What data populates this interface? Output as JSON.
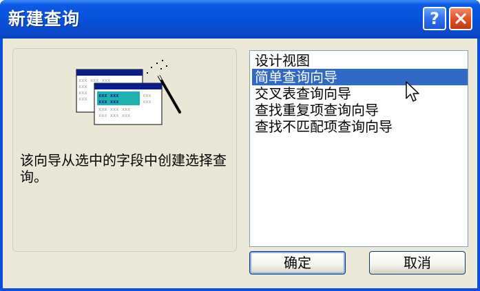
{
  "window": {
    "title": "新建查询",
    "help_glyph": "?"
  },
  "description": "该向导从选中的字段中创建选择查询。",
  "illustration": {
    "cell_text": "xxx xxx xxx"
  },
  "list": {
    "selected_index": 1,
    "items": [
      {
        "label": "设计视图"
      },
      {
        "label": "简单查询向导"
      },
      {
        "label": "交叉表查询向导"
      },
      {
        "label": "查找重复项查询向导"
      },
      {
        "label": "查找不匹配项查询向导"
      }
    ]
  },
  "buttons": {
    "ok_label": "确定",
    "cancel_label": "取消"
  },
  "colors": {
    "selection": "#316ac5",
    "titlebar": "#0a4ee0",
    "close": "#e0532a",
    "dialog_face": "#ece9d8"
  }
}
